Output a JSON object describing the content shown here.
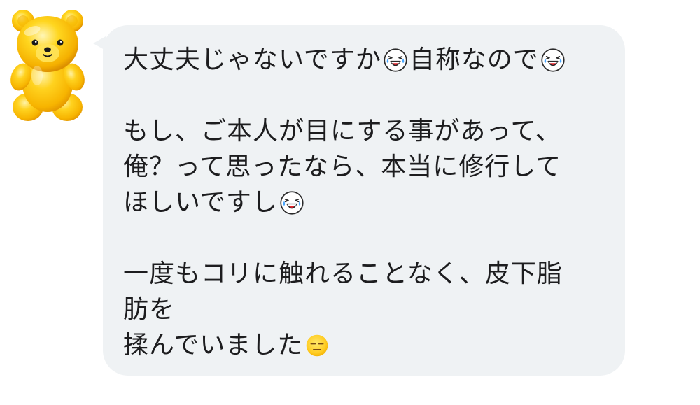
{
  "chat": {
    "sender": {
      "avatar_icon": "yellow-gummy-bear-icon"
    },
    "message": {
      "lines": [
        [
          {
            "type": "text",
            "value": "大丈夫じゃないですか"
          },
          {
            "type": "emoji",
            "icon": "laughing-crying-face-emoji"
          },
          {
            "type": "text",
            "value": "自称なので"
          },
          {
            "type": "emoji",
            "icon": "laughing-crying-face-emoji"
          }
        ],
        [],
        [
          {
            "type": "text",
            "value": "もし、ご本人が目にする事があって、"
          }
        ],
        [
          {
            "type": "text",
            "value": "俺？って思ったなら、本当に修行して"
          }
        ],
        [
          {
            "type": "text",
            "value": "ほしいですし"
          },
          {
            "type": "emoji",
            "icon": "laughing-crying-face-emoji"
          }
        ],
        [],
        [
          {
            "type": "text",
            "value": "一度もコリに触れることなく、皮下脂"
          }
        ],
        [
          {
            "type": "text",
            "value": "肪を"
          }
        ],
        [
          {
            "type": "text",
            "value": "揉んでいました"
          },
          {
            "type": "emoji",
            "icon": "expressionless-face-emoji"
          }
        ]
      ]
    }
  },
  "colors": {
    "background": "#ffffff",
    "bubble": "#eff2f4",
    "text": "#1d1d1f",
    "bear_yellow": "#ffc21a",
    "bear_shade": "#e89a00"
  }
}
